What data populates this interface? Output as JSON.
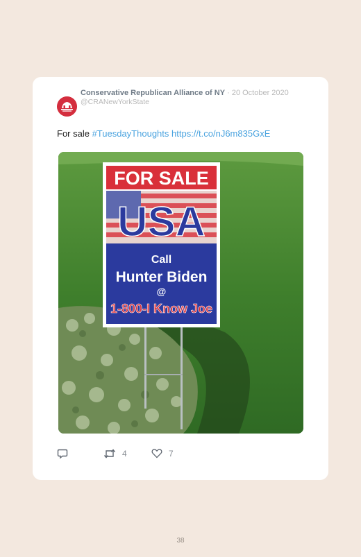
{
  "tweet": {
    "author_name": "Conservative Republican Alliance of NY",
    "separator": " · ",
    "date": "20 October 2020",
    "handle": "@CRANewYorkState",
    "text_plain": "For sale ",
    "hashtag": "#TuesdayThoughts",
    "url": "https://t.co/nJ6m835GxE",
    "image": {
      "sign_header": "FOR SALE",
      "sign_country": "USA",
      "sign_call": "Call",
      "sign_name": "Hunter Biden",
      "sign_at": "@",
      "sign_phone": "1-800-I Know Joe"
    },
    "actions": {
      "reply_icon": "reply-icon",
      "retweet_icon": "retweet-icon",
      "retweet_count": "4",
      "like_icon": "heart-icon",
      "like_count": "7"
    }
  },
  "page": {
    "number": "38"
  },
  "colors": {
    "background": "#f3e8df",
    "card": "#ffffff",
    "link": "#4aa3df",
    "name": "#6e7a86",
    "avatar": "#d42e3e",
    "sign_red": "#d9303a",
    "sign_blue": "#2b3a9e"
  }
}
